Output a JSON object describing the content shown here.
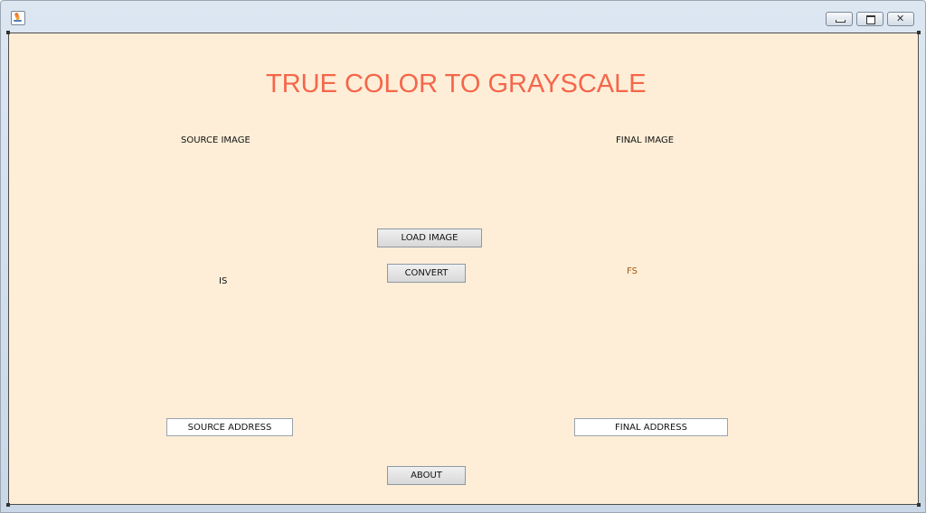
{
  "window": {
    "icon": "java-cup-icon",
    "controls": {
      "minimize": "minimize-icon",
      "maximize": "maximize-icon",
      "close": "close-icon"
    }
  },
  "main": {
    "title": "TRUE COLOR TO GRAYSCALE",
    "source_image_label": "SOURCE IMAGE",
    "final_image_label": "FINAL IMAGE",
    "source_image_placeholder": "IS",
    "final_image_placeholder": "FS",
    "load_button": "LOAD IMAGE",
    "convert_button": "CONVERT",
    "source_address": "SOURCE ADDRESS",
    "final_address": "FINAL ADDRESS",
    "about_button": "ABOUT"
  },
  "colors": {
    "panel_background": "#feeed7",
    "title_color": "#f5664b",
    "fs_label_color": "#a35b14"
  }
}
